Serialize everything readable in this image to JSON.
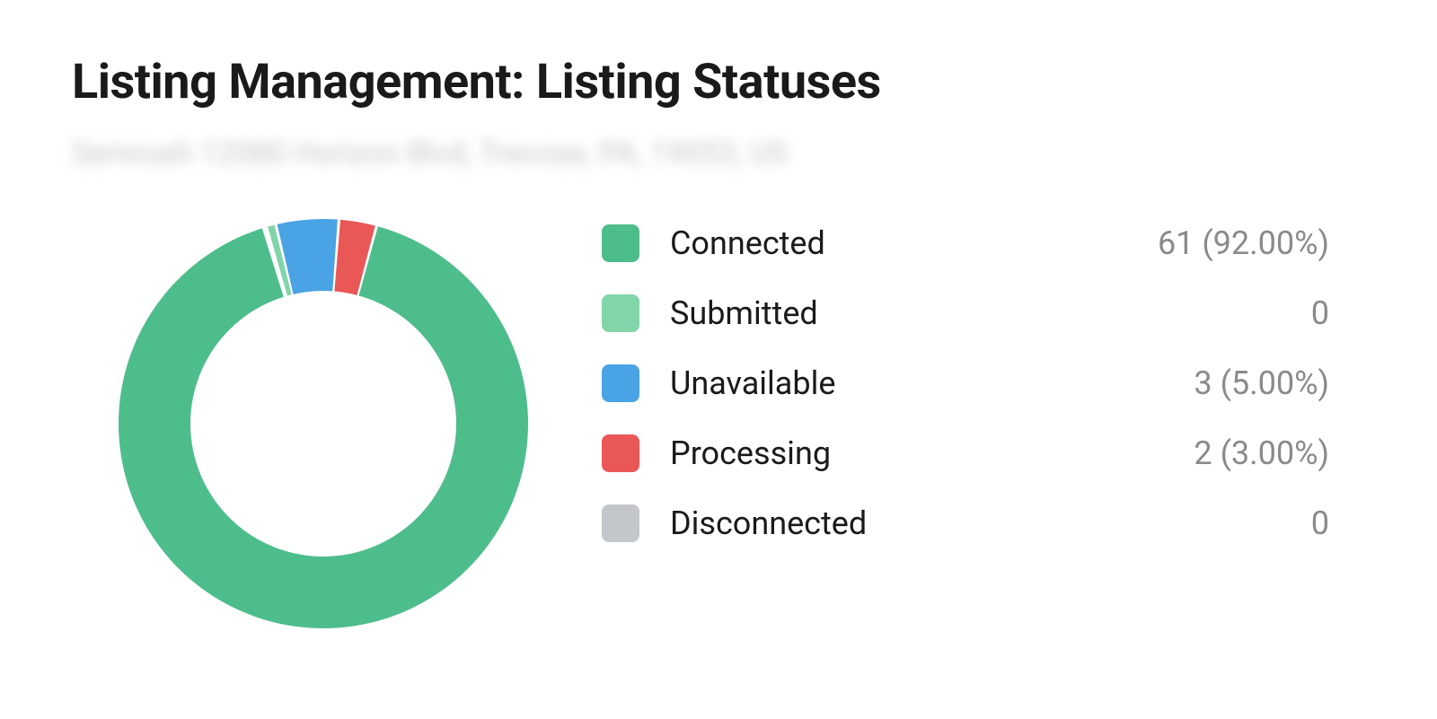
{
  "title": "Listing Management: Listing Statuses",
  "subtitle_placeholder": "Semrush 12080 Horizon Blvd, Trevose, PA, 19053, US",
  "colors": {
    "connected": "#4ebd8c",
    "submitted": "#82d4a9",
    "unavailable": "#4aa3e4",
    "processing": "#ea5757",
    "disconnected": "#c3c6ca",
    "gap": "#ffffff"
  },
  "legend": [
    {
      "key": "connected",
      "label": "Connected",
      "value_text": "61 (92.00%)"
    },
    {
      "key": "submitted",
      "label": "Submitted",
      "value_text": "0"
    },
    {
      "key": "unavailable",
      "label": "Unavailable",
      "value_text": "3 (5.00%)"
    },
    {
      "key": "processing",
      "label": "Processing",
      "value_text": "2 (3.00%)"
    },
    {
      "key": "disconnected",
      "label": "Disconnected",
      "value_text": "0"
    }
  ],
  "chart_data": {
    "type": "pie",
    "title": "Listing Management: Listing Statuses",
    "categories": [
      "Connected",
      "Submitted",
      "Unavailable",
      "Processing",
      "Disconnected"
    ],
    "values": [
      61,
      0,
      3,
      2,
      0
    ],
    "percentages": [
      92.0,
      0,
      5.0,
      3.0,
      0
    ],
    "series_colors": [
      "#4ebd8c",
      "#82d4a9",
      "#4aa3e4",
      "#ea5757",
      "#c3c6ca"
    ],
    "donut": true,
    "start_angle_deg": -107
  }
}
